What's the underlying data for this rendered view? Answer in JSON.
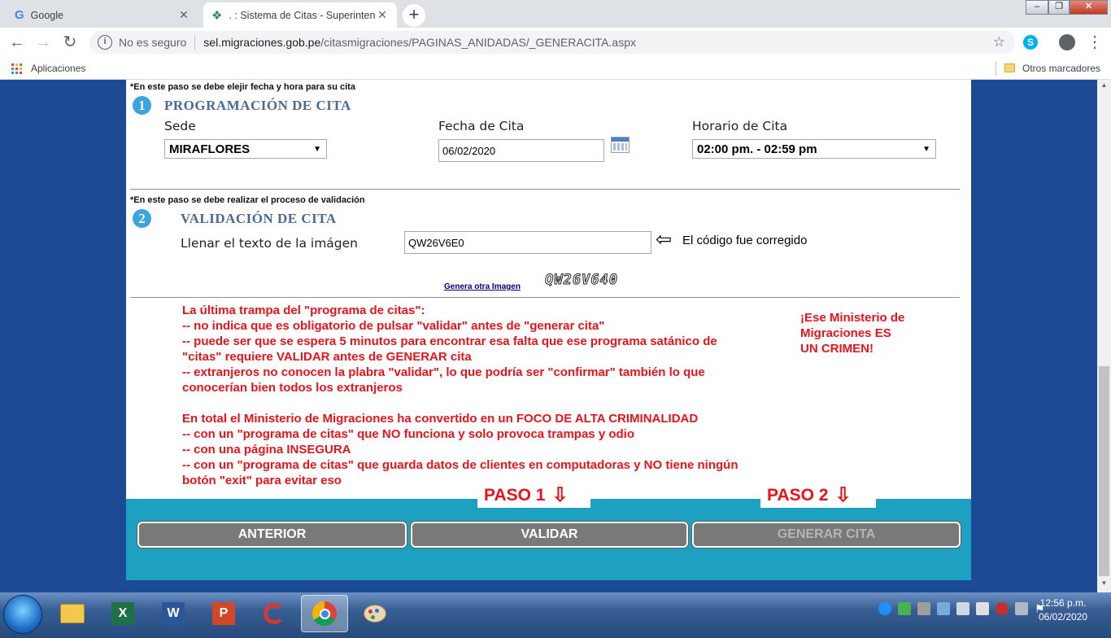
{
  "browser": {
    "tabs": [
      {
        "title": "Google"
      },
      {
        "title": ". : Sistema de Citas - Superintendencia"
      }
    ],
    "address": {
      "security": "No es seguro",
      "host": "sel.migraciones.gob.pe",
      "path": "/citasmigraciones/PAGINAS_ANIDADAS/_GENERACITA.aspx"
    },
    "bookmarks": {
      "apps": "Aplicaciones",
      "other": "Otros marcadores"
    }
  },
  "step1": {
    "note": "*En este paso se debe elejir fecha y hora para su cita",
    "number": "1",
    "title": "PROGRAMACIÓN DE CITA",
    "sede_label": "Sede",
    "sede_value": "MIRAFLORES",
    "fecha_label": "Fecha de Cita",
    "fecha_value": "06/02/2020",
    "horario_label": "Horario de Cita",
    "horario_value": "02:00 pm. - 02:59 pm"
  },
  "step2": {
    "note": "*En este paso se debe realizar el proceso de validación",
    "number": "2",
    "title": "VALIDACIÓN DE CITA",
    "captcha_label": "Llenar el texto de la imágen",
    "captcha_value": "QW26V6E0",
    "annotation": "El código fue corregido",
    "regen_link": "Genera otra Imagen",
    "captcha_image_text": "QW26V640"
  },
  "comment": {
    "lines": [
      "La última trampa del \"programa de citas\":",
      "-- no indica que es obligatorio de pulsar \"validar\" antes de \"generar cita\"",
      "-- puede ser que se espera 5 minutos para encontrar esa falta que ese programa satánico de",
      "\"citas\" requiere VALIDAR antes de GENERAR cita",
      "-- extranjeros no conocen la plabra \"validar\", lo que podría ser \"confirmar\" también lo que",
      "conocerían bien todos los extranjeros",
      "",
      "En total el Ministerio de Migraciones ha convertido en un FOCO DE ALTA CRIMINALIDAD",
      "-- con un \"programa de citas\" que NO funciona y solo provoca trampas y odio",
      "-- con una página INSEGURA",
      "-- con un \"programa de citas\" que guarda datos de clientes en computadoras y NO tiene ningún",
      "botón \"exit\" para evitar eso"
    ],
    "side": [
      "¡Ese Ministerio de",
      "Migraciones ES",
      "UN CRIMEN!"
    ]
  },
  "paso1": "PASO 1",
  "paso2": "PASO 2",
  "buttons": {
    "anterior": "ANTERIOR",
    "validar": "VALIDAR",
    "generar": "GENERAR CITA"
  },
  "clock": {
    "time": "12:56 p.m.",
    "date": "06/02/2020"
  },
  "colors": {
    "annotation_red": "#e8141c",
    "page_blue": "#1c4a94",
    "button_bar": "#1ea0c0",
    "section_heading": "#4a6996"
  }
}
